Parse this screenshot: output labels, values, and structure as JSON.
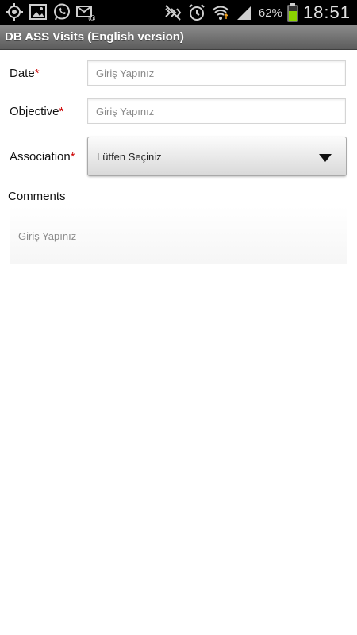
{
  "status_bar": {
    "left_icons": [
      "gps-icon",
      "image-icon",
      "whatsapp-icon",
      "email-icon"
    ],
    "right_icons": [
      "muted-icon",
      "alarm-icon",
      "wifi-icon",
      "signal-icon",
      "battery-icon"
    ],
    "battery_percent": "62%",
    "time": "18:51"
  },
  "title_bar": {
    "title": "DB ASS Visits (English version)"
  },
  "form": {
    "date": {
      "label": "Date",
      "required_mark": "*",
      "placeholder": "Giriş Yapınız"
    },
    "objective": {
      "label": "Objective",
      "required_mark": "*",
      "placeholder": "Giriş Yapınız"
    },
    "association": {
      "label": "Association",
      "required_mark": "*",
      "selected": "Lütfen Seçiniz"
    },
    "comments": {
      "label": "Comments",
      "placeholder": "Giriş Yapınız"
    }
  },
  "colors": {
    "required": "#cc0000",
    "battery": "#8bd400"
  }
}
